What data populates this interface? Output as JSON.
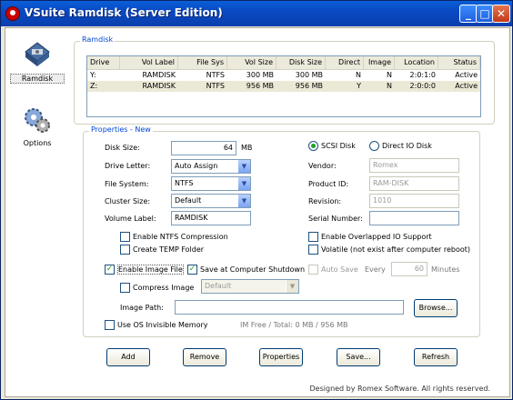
{
  "window": {
    "title": "VSuite Ramdisk (Server Edition)",
    "minimize": "_",
    "maximize": "□",
    "close": "✕"
  },
  "nav": [
    {
      "label": "Ramdisk",
      "icon": "ramdisk-icon"
    },
    {
      "label": "Options",
      "icon": "gears-icon"
    }
  ],
  "ramdisk_group": {
    "title": "Ramdisk"
  },
  "table": {
    "columns": [
      "Drive",
      "Vol Label",
      "File Sys",
      "Vol Size",
      "Disk Size",
      "Direct",
      "Image",
      "Location",
      "Status"
    ],
    "rows": [
      [
        "Y:",
        "RAMDISK",
        "NTFS",
        "300 MB",
        "300 MB",
        "N",
        "N",
        "2:0:1:0",
        "Active"
      ],
      [
        "Z:",
        "RAMDISK",
        "NTFS",
        "956 MB",
        "956 MB",
        "Y",
        "N",
        "2:0:0:0",
        "Active"
      ]
    ]
  },
  "props": {
    "title": "Properties - New",
    "disk_size_label": "Disk Size:",
    "disk_size_value": "64",
    "disk_size_unit": "MB",
    "drive_letter_label": "Drive Letter:",
    "drive_letter_value": "Auto Assign",
    "file_system_label": "File System:",
    "file_system_value": "NTFS",
    "cluster_size_label": "Cluster Size:",
    "cluster_size_value": "Default",
    "volume_label_label": "Volume Label:",
    "volume_label_value": "RAMDISK",
    "scsi_disk": "SCSI Disk",
    "direct_io_disk": "Direct IO Disk",
    "vendor_label": "Vendor:",
    "vendor_value": "Romex",
    "product_id_label": "Product ID:",
    "product_id_value": "RAM-DISK",
    "revision_label": "Revision:",
    "revision_value": "1010",
    "serial_number_label": "Serial Number:",
    "serial_number_value": "",
    "enable_ntfs_compression": "Enable NTFS Compression",
    "create_temp_folder": "Create TEMP Folder",
    "enable_overlapped_io": "Enable Overlapped IO Support",
    "volatile": "Volatile (not exist after computer reboot)",
    "enable_image_file": "Enable Image File",
    "save_at_shutdown": "Save at Computer Shutdown",
    "auto_save": "Auto Save",
    "every_label": "Every",
    "every_value": "60",
    "minutes_label": "Minutes",
    "compress_image": "Compress Image",
    "compress_level": "Default",
    "image_path_label": "Image Path:",
    "image_path_value": "",
    "browse": "Browse...",
    "use_os_invisible_memory": "Use OS Invisible Memory",
    "im_info": "IM Free / Total: 0 MB / 956 MB"
  },
  "actions": {
    "add": "Add",
    "remove": "Remove",
    "properties": "Properties",
    "save": "Save...",
    "refresh": "Refresh"
  },
  "footer": "Designed by Romex Software. All rights reserved."
}
